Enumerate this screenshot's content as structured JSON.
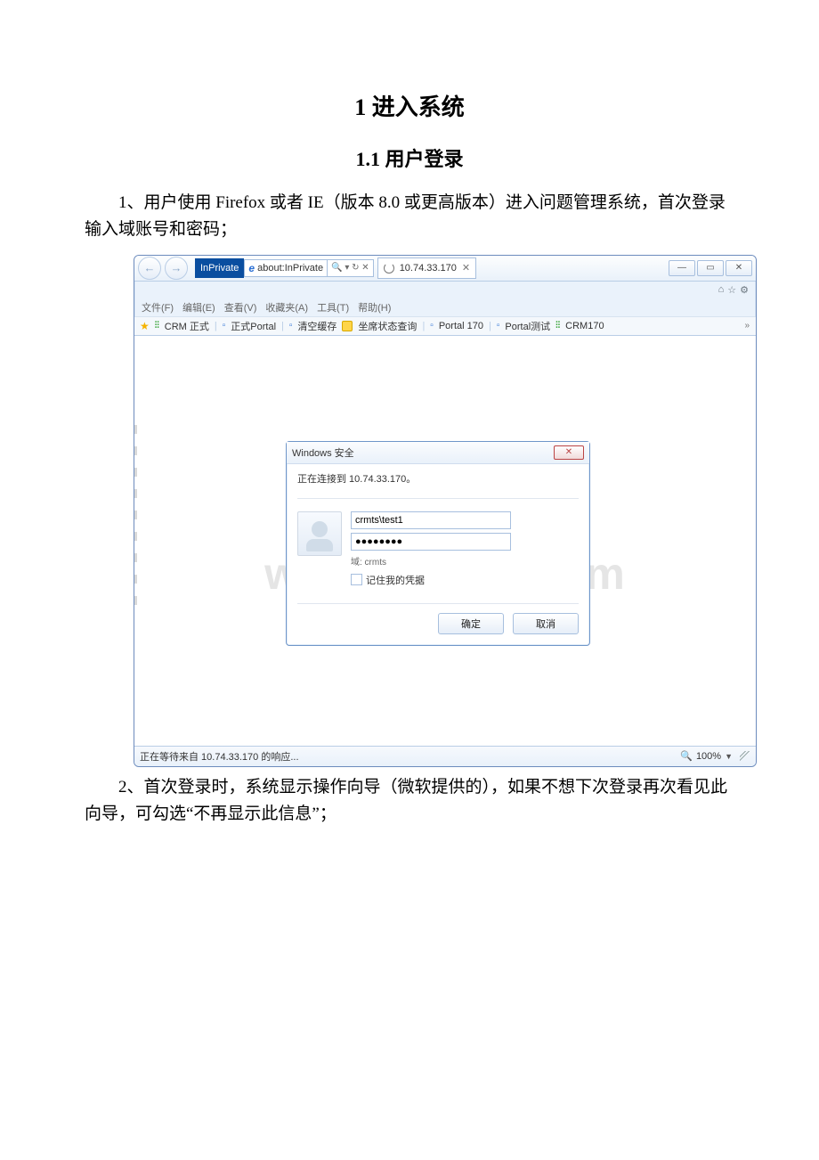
{
  "doc": {
    "h1": "1 进入系统",
    "h2": "1.1 用户登录",
    "para1": "1、用户使用 Firefox 或者 IE（版本 8.0 或更高版本）进入问题管理系统，首次登录输入域账号和密码；",
    "para2": "2、首次登录时，系统显示操作向导（微软提供的），如果不想下次登录再次看见此向导，可勾选“不再显示此信息”；"
  },
  "watermark": "www.bdocx.com",
  "browser": {
    "inprivate_label": "InPrivate",
    "address_text": "about:InPrivate",
    "search_symbols": "🔍 ▾  ↻ ✕",
    "tab_title": "10.74.33.170",
    "menus": [
      "文件(F)",
      "编辑(E)",
      "查看(V)",
      "收藏夹(A)",
      "工具(T)",
      "帮助(H)"
    ],
    "favorites": [
      "CRM 正式",
      "正式Portal",
      "清空缓存",
      "坐席状态查询",
      "Portal 170",
      "Portal测试",
      "CRM170"
    ],
    "status_text": "正在等待来自 10.74.33.170 的响应...",
    "zoom_text": "100%"
  },
  "dialog": {
    "title": "Windows 安全",
    "info": "正在连接到 10.74.33.170。",
    "username": "crmts\\test1",
    "password_mask": "●●●●●●●●",
    "domain_line": "域: crmts",
    "remember_label": "记住我的凭据",
    "ok": "确定",
    "cancel": "取消"
  }
}
